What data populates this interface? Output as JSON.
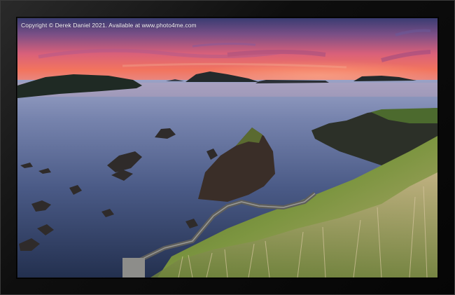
{
  "copyright_text": "Copyright © Derek Daniel 2021. Available at www.photo4me.com",
  "colors": {
    "frame": "#0e0e0e",
    "sky_top": "#3c3f74",
    "sky_glow": "#f06a5c",
    "sea": "#3f4f78",
    "grass": "#6f8a3a"
  }
}
